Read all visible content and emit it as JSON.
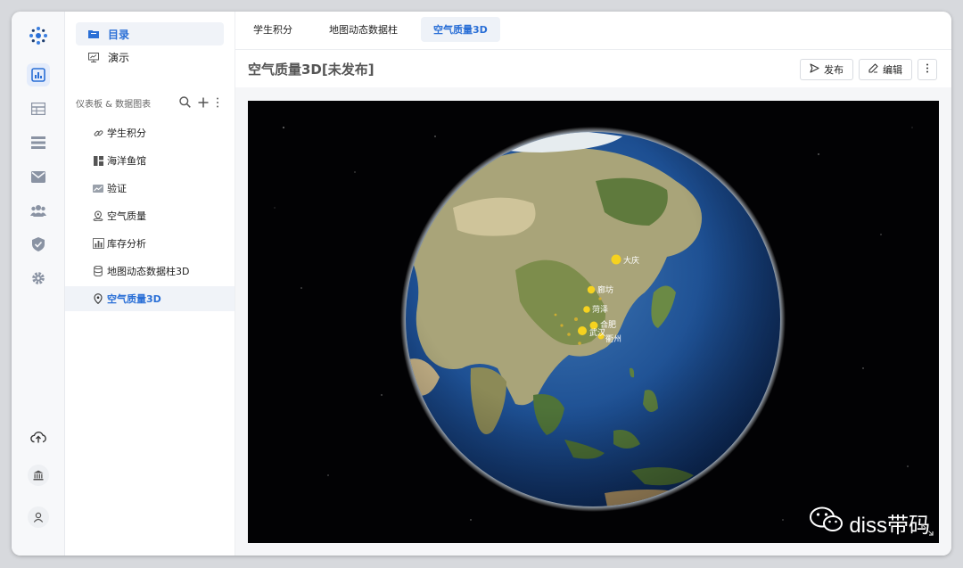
{
  "sidebar": {
    "items": [
      {
        "label": "目录",
        "icon": "folder-icon",
        "active": true
      },
      {
        "label": "演示",
        "icon": "presentation-icon",
        "active": false
      }
    ],
    "section_title": "仪表板 & 数据图表",
    "tree": [
      {
        "label": "学生积分",
        "icon": "link-icon"
      },
      {
        "label": "海洋鱼馆",
        "icon": "dashboard-icon"
      },
      {
        "label": "验证",
        "icon": "image-icon"
      },
      {
        "label": "空气质量",
        "icon": "map-pin-icon"
      },
      {
        "label": "库存分析",
        "icon": "bar-chart-icon"
      },
      {
        "label": "地图动态数据柱3D",
        "icon": "database-icon"
      },
      {
        "label": "空气质量3D",
        "icon": "location-icon",
        "active": true
      }
    ]
  },
  "tabs": [
    {
      "label": "学生积分"
    },
    {
      "label": "地图动态数据柱"
    },
    {
      "label": "空气质量3D",
      "active": true
    }
  ],
  "page": {
    "title": "空气质量3D[未发布]",
    "publish_label": "发布",
    "edit_label": "编辑"
  },
  "map": {
    "labels": [
      "大庆",
      "廊坊",
      "菏泽",
      "合肥",
      "武汉",
      "衢州"
    ]
  },
  "watermark": {
    "text": "diss带码"
  },
  "colors": {
    "accent": "#2a6fd6",
    "marker": "#f6d21f",
    "space": "#020204"
  }
}
